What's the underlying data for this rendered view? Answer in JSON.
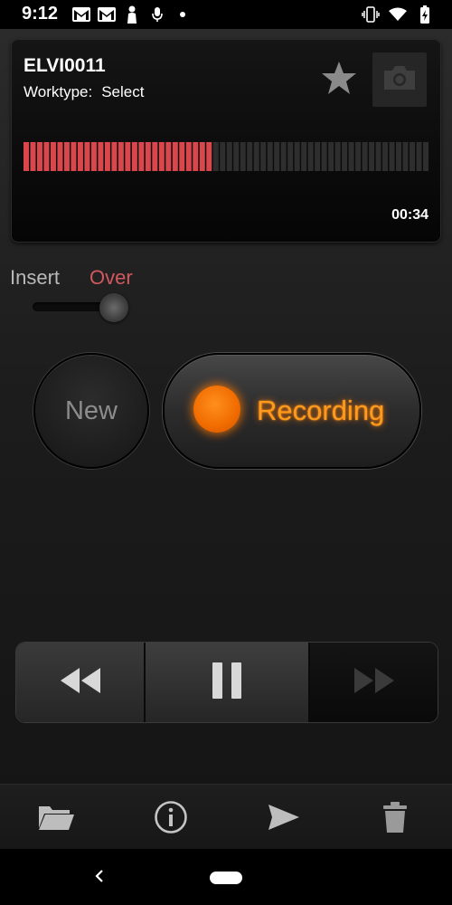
{
  "status_bar": {
    "time": "9:12",
    "left_icons": [
      "gmail-icon",
      "gmail-icon",
      "person-icon",
      "mic-icon",
      "dot-icon"
    ],
    "right_icons": [
      "vibrate-icon",
      "wifi-icon",
      "battery-icon"
    ]
  },
  "recording": {
    "file_name": "ELVI0011",
    "worktype_label": "Worktype:",
    "worktype_value": "Select",
    "elapsed": "00:34",
    "level_fraction": 0.47,
    "level_segments": 60
  },
  "mode": {
    "insert_label": "Insert",
    "over_label": "Over",
    "selected": "Over"
  },
  "buttons": {
    "new_label": "New",
    "record_label": "Recording"
  },
  "colors": {
    "accent_orange": "#ff9a1a",
    "meter_red": "#d9474d",
    "over_red": "#d0585e"
  },
  "transport": [
    "rewind-icon",
    "pause-icon",
    "fast-forward-icon"
  ],
  "toolbar": [
    "folder-icon",
    "info-icon",
    "send-icon",
    "trash-icon"
  ],
  "nav": [
    "back-icon",
    "home-pill"
  ]
}
